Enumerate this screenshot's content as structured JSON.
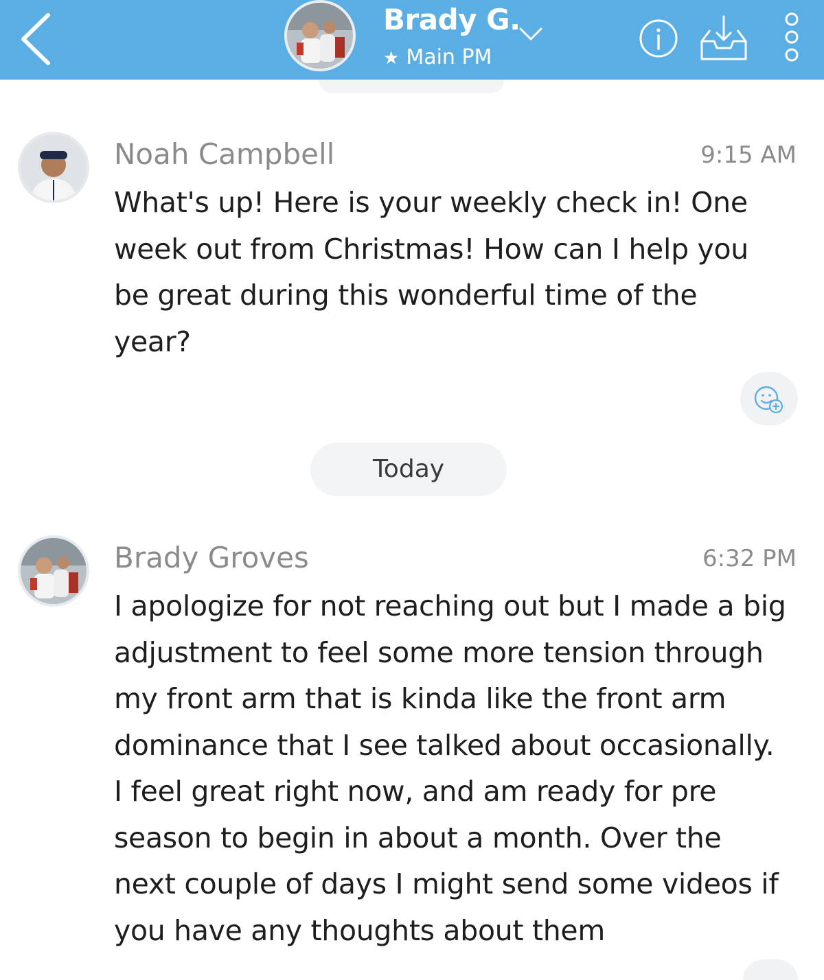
{
  "header": {
    "title": "Brady G.",
    "subtitle": "Main PM",
    "accent_color": "#5aaee3",
    "icons": [
      "back-icon",
      "chevron-down-icon",
      "star-icon",
      "info-icon",
      "inbox-download-icon",
      "more-vertical-icon"
    ]
  },
  "messages": [
    {
      "sender": "Noah Campbell",
      "time": "9:15 AM",
      "lines": [
        "What's up! Here is your weekly check in! One",
        "week out from Christmas! How can I help you",
        "be great during this wonderful time of the",
        "year?"
      ]
    },
    {
      "sender": "Brady Groves",
      "time": "6:32 PM",
      "lines": [
        "I apologize for not reaching out but I made a big",
        "adjustment to feel some more tension through",
        "my front arm that is kinda like the front arm",
        "dominance that I see talked about occasionally.",
        "I feel great right now, and am ready for pre",
        "season to begin in about a month. Over the",
        "next couple of days I might send some videos if",
        "you have any thoughts about them"
      ]
    }
  ],
  "date_divider": "Today"
}
